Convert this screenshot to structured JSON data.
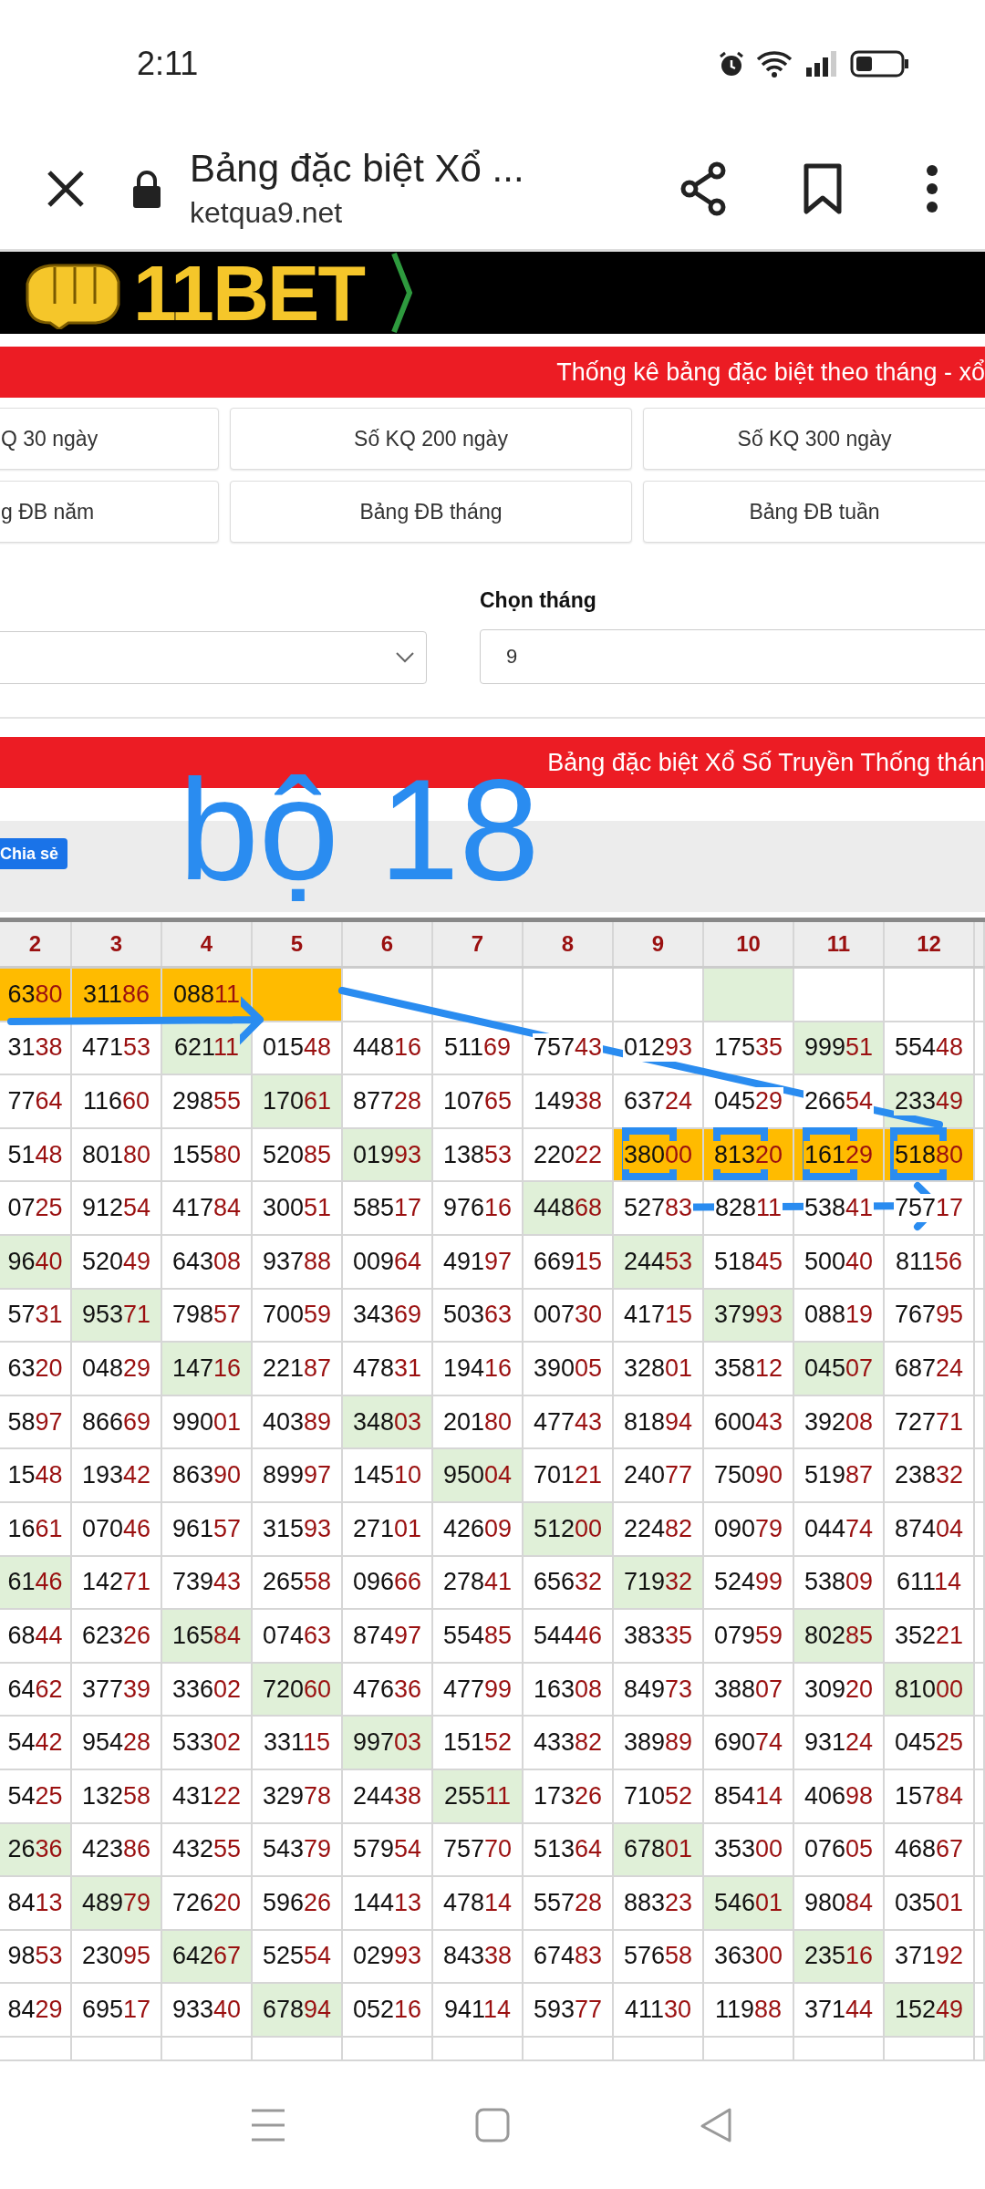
{
  "status_bar": {
    "time": "2:11"
  },
  "browser": {
    "title": "Bảng đặc biệt Xổ ...",
    "url": "ketqua9.net"
  },
  "banner": {
    "logo_text": "11BET"
  },
  "section_title": "Thống kê bảng đặc biệt theo tháng - xổ",
  "nav_buttons": [
    [
      "Q 30 ngày",
      "Số KQ 200 ngày",
      "Số KQ 300 ngày"
    ],
    [
      "g ĐB năm",
      "Bảng ĐB tháng",
      "Bảng ĐB tuần"
    ]
  ],
  "filters": {
    "month_label": "Chọn tháng",
    "month_value": "9"
  },
  "table_title": "Bảng đặc biệt Xổ Số Truyền Thống thán",
  "share_button": "Chia sẻ",
  "annotation": {
    "label": "bộ 18"
  },
  "table": {
    "columns": [
      "2",
      "3",
      "4",
      "5",
      "6",
      "7",
      "8",
      "9",
      "10",
      "11",
      "12"
    ],
    "rows": [
      {
        "cells": [
          {
            "value": "6380",
            "kind": "picked"
          },
          {
            "value": "31186",
            "kind": "picked"
          },
          {
            "value": "08811",
            "kind": "picked"
          },
          {
            "kind": "picked"
          },
          {
            "kind": "plain"
          },
          {
            "kind": "plain"
          },
          {
            "kind": "plain"
          },
          {
            "kind": "plain"
          },
          {
            "kind": "hit"
          },
          {
            "kind": "plain"
          },
          {
            "kind": "plain"
          }
        ]
      },
      {
        "cells": [
          {
            "value": "3138",
            "kind": "plain"
          },
          {
            "value": "47153",
            "kind": "plain"
          },
          {
            "value": "62111",
            "kind": "hit"
          },
          {
            "value": "01548",
            "kind": "plain"
          },
          {
            "value": "44816",
            "kind": "plain"
          },
          {
            "value": "51169",
            "kind": "plain"
          },
          {
            "value": "75743",
            "kind": "plain"
          },
          {
            "value": "01293",
            "kind": "plain"
          },
          {
            "value": "17535",
            "kind": "plain"
          },
          {
            "value": "99951",
            "kind": "hit"
          },
          {
            "value": "55448",
            "kind": "plain"
          }
        ]
      },
      {
        "cells": [
          {
            "value": "7764",
            "kind": "plain"
          },
          {
            "value": "11660",
            "kind": "plain"
          },
          {
            "value": "29855",
            "kind": "plain"
          },
          {
            "value": "17061",
            "kind": "hit"
          },
          {
            "value": "87728",
            "kind": "plain"
          },
          {
            "value": "10765",
            "kind": "plain"
          },
          {
            "value": "14938",
            "kind": "plain"
          },
          {
            "value": "63724",
            "kind": "plain"
          },
          {
            "value": "04529",
            "kind": "plain"
          },
          {
            "value": "26654",
            "kind": "plain"
          },
          {
            "value": "23349",
            "kind": "hit"
          }
        ]
      },
      {
        "cells": [
          {
            "value": "5148",
            "kind": "plain"
          },
          {
            "value": "80180",
            "kind": "plain"
          },
          {
            "value": "15580",
            "kind": "plain"
          },
          {
            "value": "52085",
            "kind": "plain"
          },
          {
            "value": "01993",
            "kind": "hit"
          },
          {
            "value": "13853",
            "kind": "plain"
          },
          {
            "value": "22022",
            "kind": "plain"
          },
          {
            "value": "38000",
            "kind": "picked"
          },
          {
            "value": "81320",
            "kind": "picked"
          },
          {
            "value": "16129",
            "kind": "picked"
          },
          {
            "value": "51880",
            "kind": "picked"
          }
        ]
      },
      {
        "cells": [
          {
            "value": "0725",
            "kind": "plain"
          },
          {
            "value": "91254",
            "kind": "plain"
          },
          {
            "value": "41784",
            "kind": "plain"
          },
          {
            "value": "30051",
            "kind": "plain"
          },
          {
            "value": "58517",
            "kind": "plain"
          },
          {
            "value": "97616",
            "kind": "plain"
          },
          {
            "value": "44868",
            "kind": "hit"
          },
          {
            "value": "52783",
            "kind": "plain"
          },
          {
            "value": "82811",
            "kind": "plain"
          },
          {
            "value": "53841",
            "kind": "plain"
          },
          {
            "value": "75717",
            "kind": "plain"
          }
        ]
      },
      {
        "cells": [
          {
            "value": "9640",
            "kind": "hit"
          },
          {
            "value": "52049",
            "kind": "plain"
          },
          {
            "value": "64308",
            "kind": "plain"
          },
          {
            "value": "93788",
            "kind": "plain"
          },
          {
            "value": "00964",
            "kind": "plain"
          },
          {
            "value": "49197",
            "kind": "plain"
          },
          {
            "value": "66915",
            "kind": "plain"
          },
          {
            "value": "24453",
            "kind": "hit"
          },
          {
            "value": "51845",
            "kind": "plain"
          },
          {
            "value": "50040",
            "kind": "plain"
          },
          {
            "value": "81156",
            "kind": "plain"
          }
        ]
      },
      {
        "cells": [
          {
            "value": "5731",
            "kind": "plain"
          },
          {
            "value": "95371",
            "kind": "hit"
          },
          {
            "value": "79857",
            "kind": "plain"
          },
          {
            "value": "70059",
            "kind": "plain"
          },
          {
            "value": "34369",
            "kind": "plain"
          },
          {
            "value": "50363",
            "kind": "plain"
          },
          {
            "value": "00730",
            "kind": "plain"
          },
          {
            "value": "41715",
            "kind": "plain"
          },
          {
            "value": "37993",
            "kind": "hit"
          },
          {
            "value": "08819",
            "kind": "plain"
          },
          {
            "value": "76795",
            "kind": "plain"
          }
        ]
      },
      {
        "cells": [
          {
            "value": "6320",
            "kind": "plain"
          },
          {
            "value": "04829",
            "kind": "plain"
          },
          {
            "value": "14716",
            "kind": "hit"
          },
          {
            "value": "22187",
            "kind": "plain"
          },
          {
            "value": "47831",
            "kind": "plain"
          },
          {
            "value": "19416",
            "kind": "plain"
          },
          {
            "value": "39005",
            "kind": "plain"
          },
          {
            "value": "32801",
            "kind": "plain"
          },
          {
            "value": "35812",
            "kind": "plain"
          },
          {
            "value": "04507",
            "kind": "hit"
          },
          {
            "value": "68724",
            "kind": "plain"
          }
        ]
      },
      {
        "cells": [
          {
            "value": "5897",
            "kind": "plain"
          },
          {
            "value": "86669",
            "kind": "plain"
          },
          {
            "value": "99001",
            "kind": "plain"
          },
          {
            "value": "40389",
            "kind": "plain"
          },
          {
            "value": "34803",
            "kind": "hit"
          },
          {
            "value": "20180",
            "kind": "plain"
          },
          {
            "value": "47743",
            "kind": "plain"
          },
          {
            "value": "81894",
            "kind": "plain"
          },
          {
            "value": "60043",
            "kind": "plain"
          },
          {
            "value": "39208",
            "kind": "plain"
          },
          {
            "value": "72771",
            "kind": "plain"
          }
        ]
      },
      {
        "cells": [
          {
            "value": "1548",
            "kind": "plain"
          },
          {
            "value": "19342",
            "kind": "plain"
          },
          {
            "value": "86390",
            "kind": "plain"
          },
          {
            "value": "89997",
            "kind": "plain"
          },
          {
            "value": "14510",
            "kind": "plain"
          },
          {
            "value": "95004",
            "kind": "hit"
          },
          {
            "value": "70121",
            "kind": "plain"
          },
          {
            "value": "24077",
            "kind": "plain"
          },
          {
            "value": "75090",
            "kind": "plain"
          },
          {
            "value": "51987",
            "kind": "plain"
          },
          {
            "value": "23832",
            "kind": "plain"
          }
        ]
      },
      {
        "cells": [
          {
            "value": "1661",
            "kind": "plain"
          },
          {
            "value": "07046",
            "kind": "plain"
          },
          {
            "value": "96157",
            "kind": "plain"
          },
          {
            "value": "31593",
            "kind": "plain"
          },
          {
            "value": "27101",
            "kind": "plain"
          },
          {
            "value": "42609",
            "kind": "plain"
          },
          {
            "value": "51200",
            "kind": "hit"
          },
          {
            "value": "22482",
            "kind": "plain"
          },
          {
            "value": "09079",
            "kind": "plain"
          },
          {
            "value": "04474",
            "kind": "plain"
          },
          {
            "value": "87404",
            "kind": "plain"
          }
        ]
      },
      {
        "cells": [
          {
            "value": "6146",
            "kind": "hit"
          },
          {
            "value": "14271",
            "kind": "plain"
          },
          {
            "value": "73943",
            "kind": "plain"
          },
          {
            "value": "26558",
            "kind": "plain"
          },
          {
            "value": "09666",
            "kind": "plain"
          },
          {
            "value": "27841",
            "kind": "plain"
          },
          {
            "value": "65632",
            "kind": "plain"
          },
          {
            "value": "71932",
            "kind": "hit"
          },
          {
            "value": "52499",
            "kind": "plain"
          },
          {
            "value": "53809",
            "kind": "plain"
          },
          {
            "value": "61114",
            "kind": "plain"
          }
        ]
      },
      {
        "cells": [
          {
            "value": "6844",
            "kind": "plain"
          },
          {
            "value": "62326",
            "kind": "plain"
          },
          {
            "value": "16584",
            "kind": "hit"
          },
          {
            "value": "07463",
            "kind": "plain"
          },
          {
            "value": "87497",
            "kind": "plain"
          },
          {
            "value": "55485",
            "kind": "plain"
          },
          {
            "value": "54446",
            "kind": "plain"
          },
          {
            "value": "38335",
            "kind": "plain"
          },
          {
            "value": "07959",
            "kind": "plain"
          },
          {
            "value": "80285",
            "kind": "hit"
          },
          {
            "value": "35221",
            "kind": "plain"
          }
        ]
      },
      {
        "cells": [
          {
            "value": "6462",
            "kind": "plain"
          },
          {
            "value": "37739",
            "kind": "plain"
          },
          {
            "value": "33602",
            "kind": "plain"
          },
          {
            "value": "72060",
            "kind": "hit"
          },
          {
            "value": "47636",
            "kind": "plain"
          },
          {
            "value": "47799",
            "kind": "plain"
          },
          {
            "value": "16308",
            "kind": "plain"
          },
          {
            "value": "84973",
            "kind": "plain"
          },
          {
            "value": "38807",
            "kind": "plain"
          },
          {
            "value": "30920",
            "kind": "plain"
          },
          {
            "value": "81000",
            "kind": "hit"
          }
        ]
      },
      {
        "cells": [
          {
            "value": "5442",
            "kind": "plain"
          },
          {
            "value": "95428",
            "kind": "plain"
          },
          {
            "value": "53302",
            "kind": "plain"
          },
          {
            "value": "33115",
            "kind": "plain"
          },
          {
            "value": "99703",
            "kind": "hit"
          },
          {
            "value": "15152",
            "kind": "plain"
          },
          {
            "value": "43382",
            "kind": "plain"
          },
          {
            "value": "38989",
            "kind": "plain"
          },
          {
            "value": "69074",
            "kind": "plain"
          },
          {
            "value": "93124",
            "kind": "plain"
          },
          {
            "value": "04525",
            "kind": "plain"
          }
        ]
      },
      {
        "cells": [
          {
            "value": "5425",
            "kind": "plain"
          },
          {
            "value": "13258",
            "kind": "plain"
          },
          {
            "value": "43122",
            "kind": "plain"
          },
          {
            "value": "32978",
            "kind": "plain"
          },
          {
            "value": "24438",
            "kind": "plain"
          },
          {
            "value": "25511",
            "kind": "hit"
          },
          {
            "value": "17326",
            "kind": "plain"
          },
          {
            "value": "71052",
            "kind": "plain"
          },
          {
            "value": "85414",
            "kind": "plain"
          },
          {
            "value": "40698",
            "kind": "plain"
          },
          {
            "value": "15784",
            "kind": "plain"
          }
        ]
      },
      {
        "cells": [
          {
            "value": "2636",
            "kind": "hit"
          },
          {
            "value": "42386",
            "kind": "plain"
          },
          {
            "value": "43255",
            "kind": "plain"
          },
          {
            "value": "54379",
            "kind": "plain"
          },
          {
            "value": "57954",
            "kind": "plain"
          },
          {
            "value": "75770",
            "kind": "plain"
          },
          {
            "value": "51364",
            "kind": "plain"
          },
          {
            "value": "67801",
            "kind": "hit"
          },
          {
            "value": "35300",
            "kind": "plain"
          },
          {
            "value": "07605",
            "kind": "plain"
          },
          {
            "value": "46867",
            "kind": "plain"
          }
        ]
      },
      {
        "cells": [
          {
            "value": "8413",
            "kind": "plain"
          },
          {
            "value": "48979",
            "kind": "hit"
          },
          {
            "value": "72620",
            "kind": "plain"
          },
          {
            "value": "59626",
            "kind": "plain"
          },
          {
            "value": "14413",
            "kind": "plain"
          },
          {
            "value": "47814",
            "kind": "plain"
          },
          {
            "value": "55728",
            "kind": "plain"
          },
          {
            "value": "88323",
            "kind": "plain"
          },
          {
            "value": "54601",
            "kind": "hit"
          },
          {
            "value": "98084",
            "kind": "plain"
          },
          {
            "value": "03501",
            "kind": "plain"
          }
        ]
      },
      {
        "cells": [
          {
            "value": "9853",
            "kind": "plain"
          },
          {
            "value": "23095",
            "kind": "plain"
          },
          {
            "value": "64267",
            "kind": "hit"
          },
          {
            "value": "52554",
            "kind": "plain"
          },
          {
            "value": "02993",
            "kind": "plain"
          },
          {
            "value": "84338",
            "kind": "plain"
          },
          {
            "value": "67483",
            "kind": "plain"
          },
          {
            "value": "57658",
            "kind": "plain"
          },
          {
            "value": "36300",
            "kind": "plain"
          },
          {
            "value": "23516",
            "kind": "hit"
          },
          {
            "value": "37192",
            "kind": "plain"
          }
        ]
      },
      {
        "cells": [
          {
            "value": "8429",
            "kind": "plain"
          },
          {
            "value": "69517",
            "kind": "plain"
          },
          {
            "value": "93340",
            "kind": "plain"
          },
          {
            "value": "67894",
            "kind": "hit"
          },
          {
            "value": "05216",
            "kind": "plain"
          },
          {
            "value": "94114",
            "kind": "plain"
          },
          {
            "value": "59377",
            "kind": "plain"
          },
          {
            "value": "41130",
            "kind": "plain"
          },
          {
            "value": "11988",
            "kind": "plain"
          },
          {
            "value": "37144",
            "kind": "plain"
          },
          {
            "value": "15249",
            "kind": "hit"
          }
        ]
      }
    ]
  }
}
